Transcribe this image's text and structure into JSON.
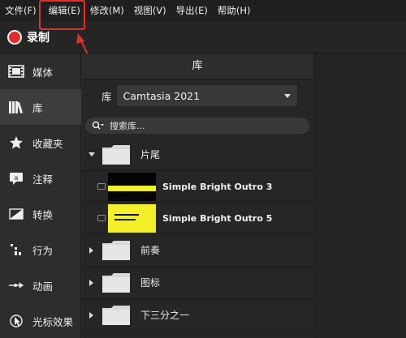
{
  "menu": {
    "items": [
      "文件(F)",
      "编辑(E)",
      "修改(M)",
      "视图(V)",
      "导出(E)",
      "帮助(H)"
    ]
  },
  "record": {
    "label": "录制"
  },
  "sidebar": {
    "items": [
      {
        "label": "媒体",
        "icon": "film-icon"
      },
      {
        "label": "库",
        "icon": "library-books-icon"
      },
      {
        "label": "收藏夹",
        "icon": "star-icon"
      },
      {
        "label": "注释",
        "icon": "callout-icon"
      },
      {
        "label": "转换",
        "icon": "transition-icon"
      },
      {
        "label": "行为",
        "icon": "behavior-icon"
      },
      {
        "label": "动画",
        "icon": "animation-arrow-icon"
      },
      {
        "label": "光标效果",
        "icon": "cursor-effects-icon"
      }
    ]
  },
  "library": {
    "header": "库",
    "row_label": "库",
    "selected": "Camtasia 2021",
    "search_placeholder": "搜索库...",
    "folders": [
      {
        "name": "片尾",
        "expanded": true
      },
      {
        "name": "前奏",
        "expanded": false
      },
      {
        "name": "图标",
        "expanded": false
      },
      {
        "name": "下三分之一",
        "expanded": false
      }
    ],
    "assets": [
      {
        "name": "Simple Bright Outro 3",
        "thumb_bg": "#050505",
        "band": "#f3f02a"
      },
      {
        "name": "Simple Bright Outro 5",
        "thumb_bg": "#f3f02a",
        "band": "#111111"
      }
    ]
  },
  "colors": {
    "accent_red": "#e22c2c",
    "highlight": "#e0312c",
    "panel_bg": "#262626"
  }
}
